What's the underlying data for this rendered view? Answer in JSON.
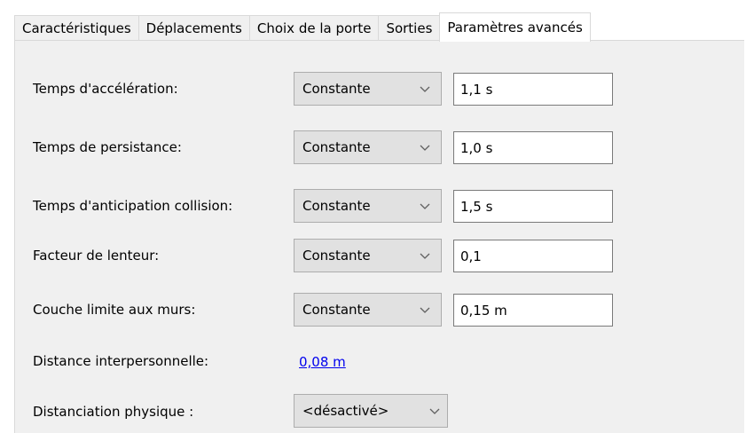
{
  "tabs": [
    {
      "label": "Caractéristiques",
      "active": false
    },
    {
      "label": "Déplacements",
      "active": false
    },
    {
      "label": "Choix de la porte",
      "active": false
    },
    {
      "label": "Sorties",
      "active": false
    },
    {
      "label": "Paramètres avancés",
      "active": true
    }
  ],
  "params": {
    "acceleration": {
      "label": "Temps d'accélération:",
      "mode": "Constante",
      "value": "1,1 s"
    },
    "persistence": {
      "label": "Temps de persistance:",
      "mode": "Constante",
      "value": "1,0 s"
    },
    "anticipation": {
      "label": "Temps d'anticipation collision:",
      "mode": "Constante",
      "value": "1,5 s"
    },
    "slowness": {
      "label": "Facteur de lenteur:",
      "mode": "Constante",
      "value": "0,1"
    },
    "wall_layer": {
      "label": "Couche limite aux murs:",
      "mode": "Constante",
      "value": "0,15 m"
    },
    "interpersonal": {
      "label": "Distance interpersonnelle:",
      "value": "0,08 m"
    },
    "physical_distancing": {
      "label": "Distanciation physique :",
      "mode": "<désactivé>"
    }
  },
  "icons": {
    "dropdown": "chevron-down-icon"
  },
  "colors": {
    "panel_background": "#f0f0f0",
    "active_tab_background": "#ffffff",
    "combo_background": "#e1e1e1",
    "link": "#0000ee"
  }
}
